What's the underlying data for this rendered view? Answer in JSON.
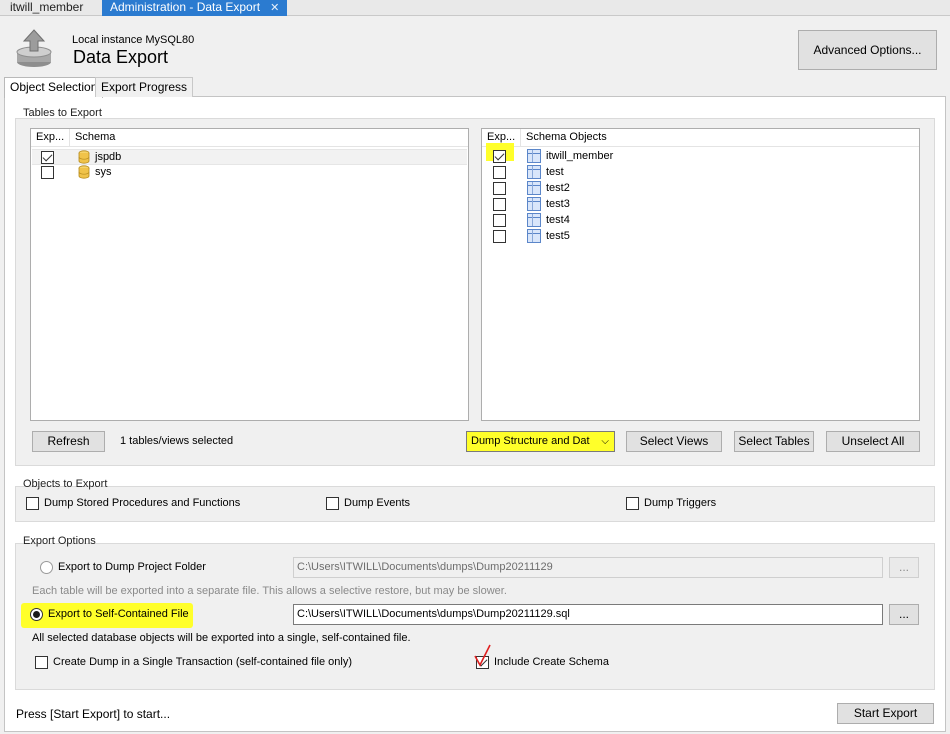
{
  "doc_tabs": [
    {
      "label": "itwill_member"
    },
    {
      "label": "Administration - Data Export"
    }
  ],
  "header": {
    "subtitle": "Local instance MySQL80",
    "title": "Data Export",
    "advanced_button": "Advanced Options..."
  },
  "page_tabs": [
    {
      "label": "Object Selection"
    },
    {
      "label": "Export Progress"
    }
  ],
  "tables_to_export": {
    "label": "Tables to Export",
    "schema_list": {
      "col_export": "Exp...",
      "col_schema": "Schema",
      "rows": [
        {
          "name": "jspdb",
          "checked": true
        },
        {
          "name": "sys",
          "checked": false
        }
      ]
    },
    "objects_list": {
      "col_export": "Exp...",
      "col_objects": "Schema Objects",
      "rows": [
        {
          "name": "itwill_member",
          "checked": true
        },
        {
          "name": "test",
          "checked": false
        },
        {
          "name": "test2",
          "checked": false
        },
        {
          "name": "test3",
          "checked": false
        },
        {
          "name": "test4",
          "checked": false
        },
        {
          "name": "test5",
          "checked": false
        }
      ]
    },
    "refresh_button": "Refresh",
    "selected_count": "1 tables/views selected",
    "dump_mode": "Dump Structure and Dat",
    "select_views_button": "Select Views",
    "select_tables_button": "Select Tables",
    "unselect_all_button": "Unselect All"
  },
  "objects_to_export": {
    "label": "Objects to Export",
    "stored_procs": "Dump Stored Procedures and Functions",
    "events": "Dump Events",
    "triggers": "Dump Triggers"
  },
  "export_options": {
    "label": "Export Options",
    "project_folder_radio": "Export to Dump Project Folder",
    "project_folder_path": "C:\\Users\\ITWILL\\Documents\\dumps\\Dump20211129",
    "project_folder_hint": "Each table will be exported into a separate file. This allows a selective restore, but may be slower.",
    "browse_label": "...",
    "self_contained_radio": "Export to Self-Contained File",
    "self_contained_path": "C:\\Users\\ITWILL\\Documents\\dumps\\Dump20211129.sql",
    "self_contained_hint": "All selected database objects will be exported into a single, self-contained file.",
    "single_transaction": "Create Dump in a Single Transaction (self-contained file only)",
    "include_schema": "Include Create Schema"
  },
  "status_text": "Press [Start Export] to start...",
  "start_button": "Start Export",
  "colors": {
    "highlight": "#ffff2a",
    "active_tab": "#2b7bd0",
    "annotation": "#e02020"
  }
}
